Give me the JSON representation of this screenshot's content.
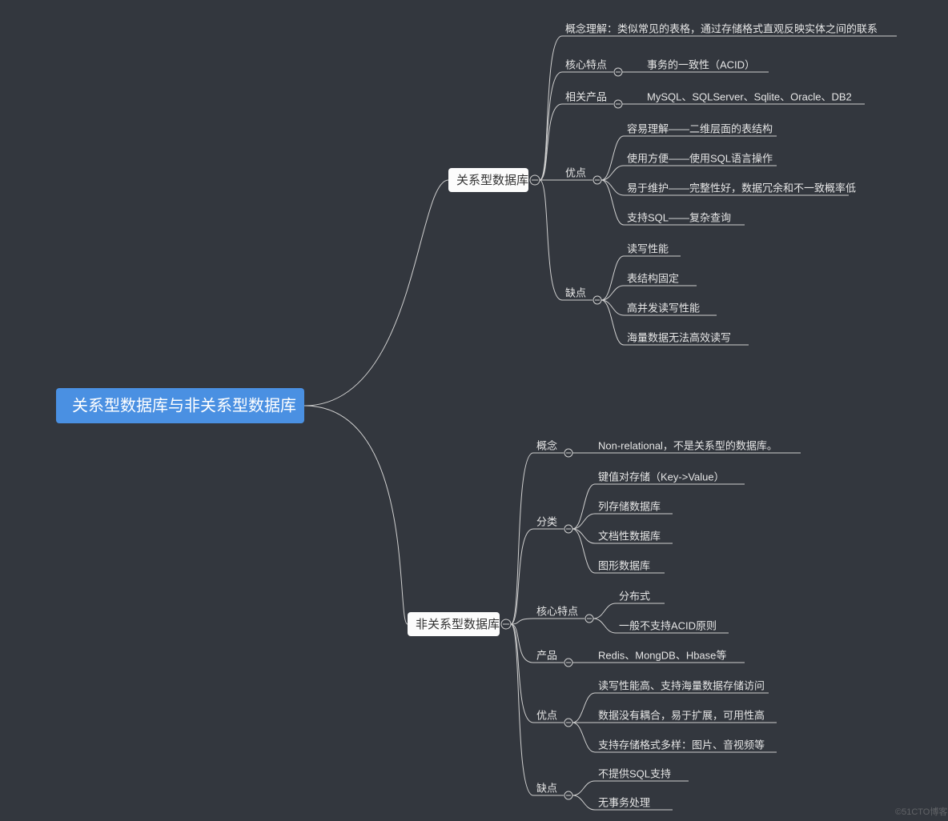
{
  "root": "关系型数据库与非关系型数据库",
  "watermark": "©51CTO博客",
  "branch1": {
    "title": "关系型数据库",
    "cats": [
      {
        "label": "概念理解：类似常见的表格，通过存储格式直观反映实体之间的联系",
        "inline": true
      },
      {
        "label": "核心特点",
        "children": [
          "事务的一致性（ACID）"
        ]
      },
      {
        "label": "相关产品",
        "children": [
          "MySQL、SQLServer、Sqlite、Oracle、DB2"
        ]
      },
      {
        "label": "优点",
        "children": [
          "容易理解——二维层面的表结构",
          "使用方便——使用SQL语言操作",
          "易于维护——完整性好，数据冗余和不一致概率低",
          "支持SQL——复杂查询"
        ]
      },
      {
        "label": "缺点",
        "children": [
          "读写性能",
          "表结构固定",
          "高并发读写性能",
          "海量数据无法高效读写"
        ]
      }
    ]
  },
  "branch2": {
    "title": "非关系型数据库",
    "cats": [
      {
        "label": "概念",
        "children": [
          "Non-relational，不是关系型的数据库。"
        ]
      },
      {
        "label": "分类",
        "children": [
          "键值对存储（Key->Value）",
          "列存储数据库",
          "文档性数据库",
          "图形数据库"
        ]
      },
      {
        "label": "核心特点",
        "children": [
          "分布式",
          "一般不支持ACID原则"
        ]
      },
      {
        "label": "产品",
        "children": [
          "Redis、MongDB、Hbase等"
        ]
      },
      {
        "label": "优点",
        "children": [
          "读写性能高、支持海量数据存储访问",
          "数据没有耦合，易于扩展，可用性高",
          "支持存储格式多样：图片、音视频等"
        ]
      },
      {
        "label": "缺点",
        "children": [
          "不提供SQL支持",
          "无事务处理"
        ]
      }
    ]
  }
}
